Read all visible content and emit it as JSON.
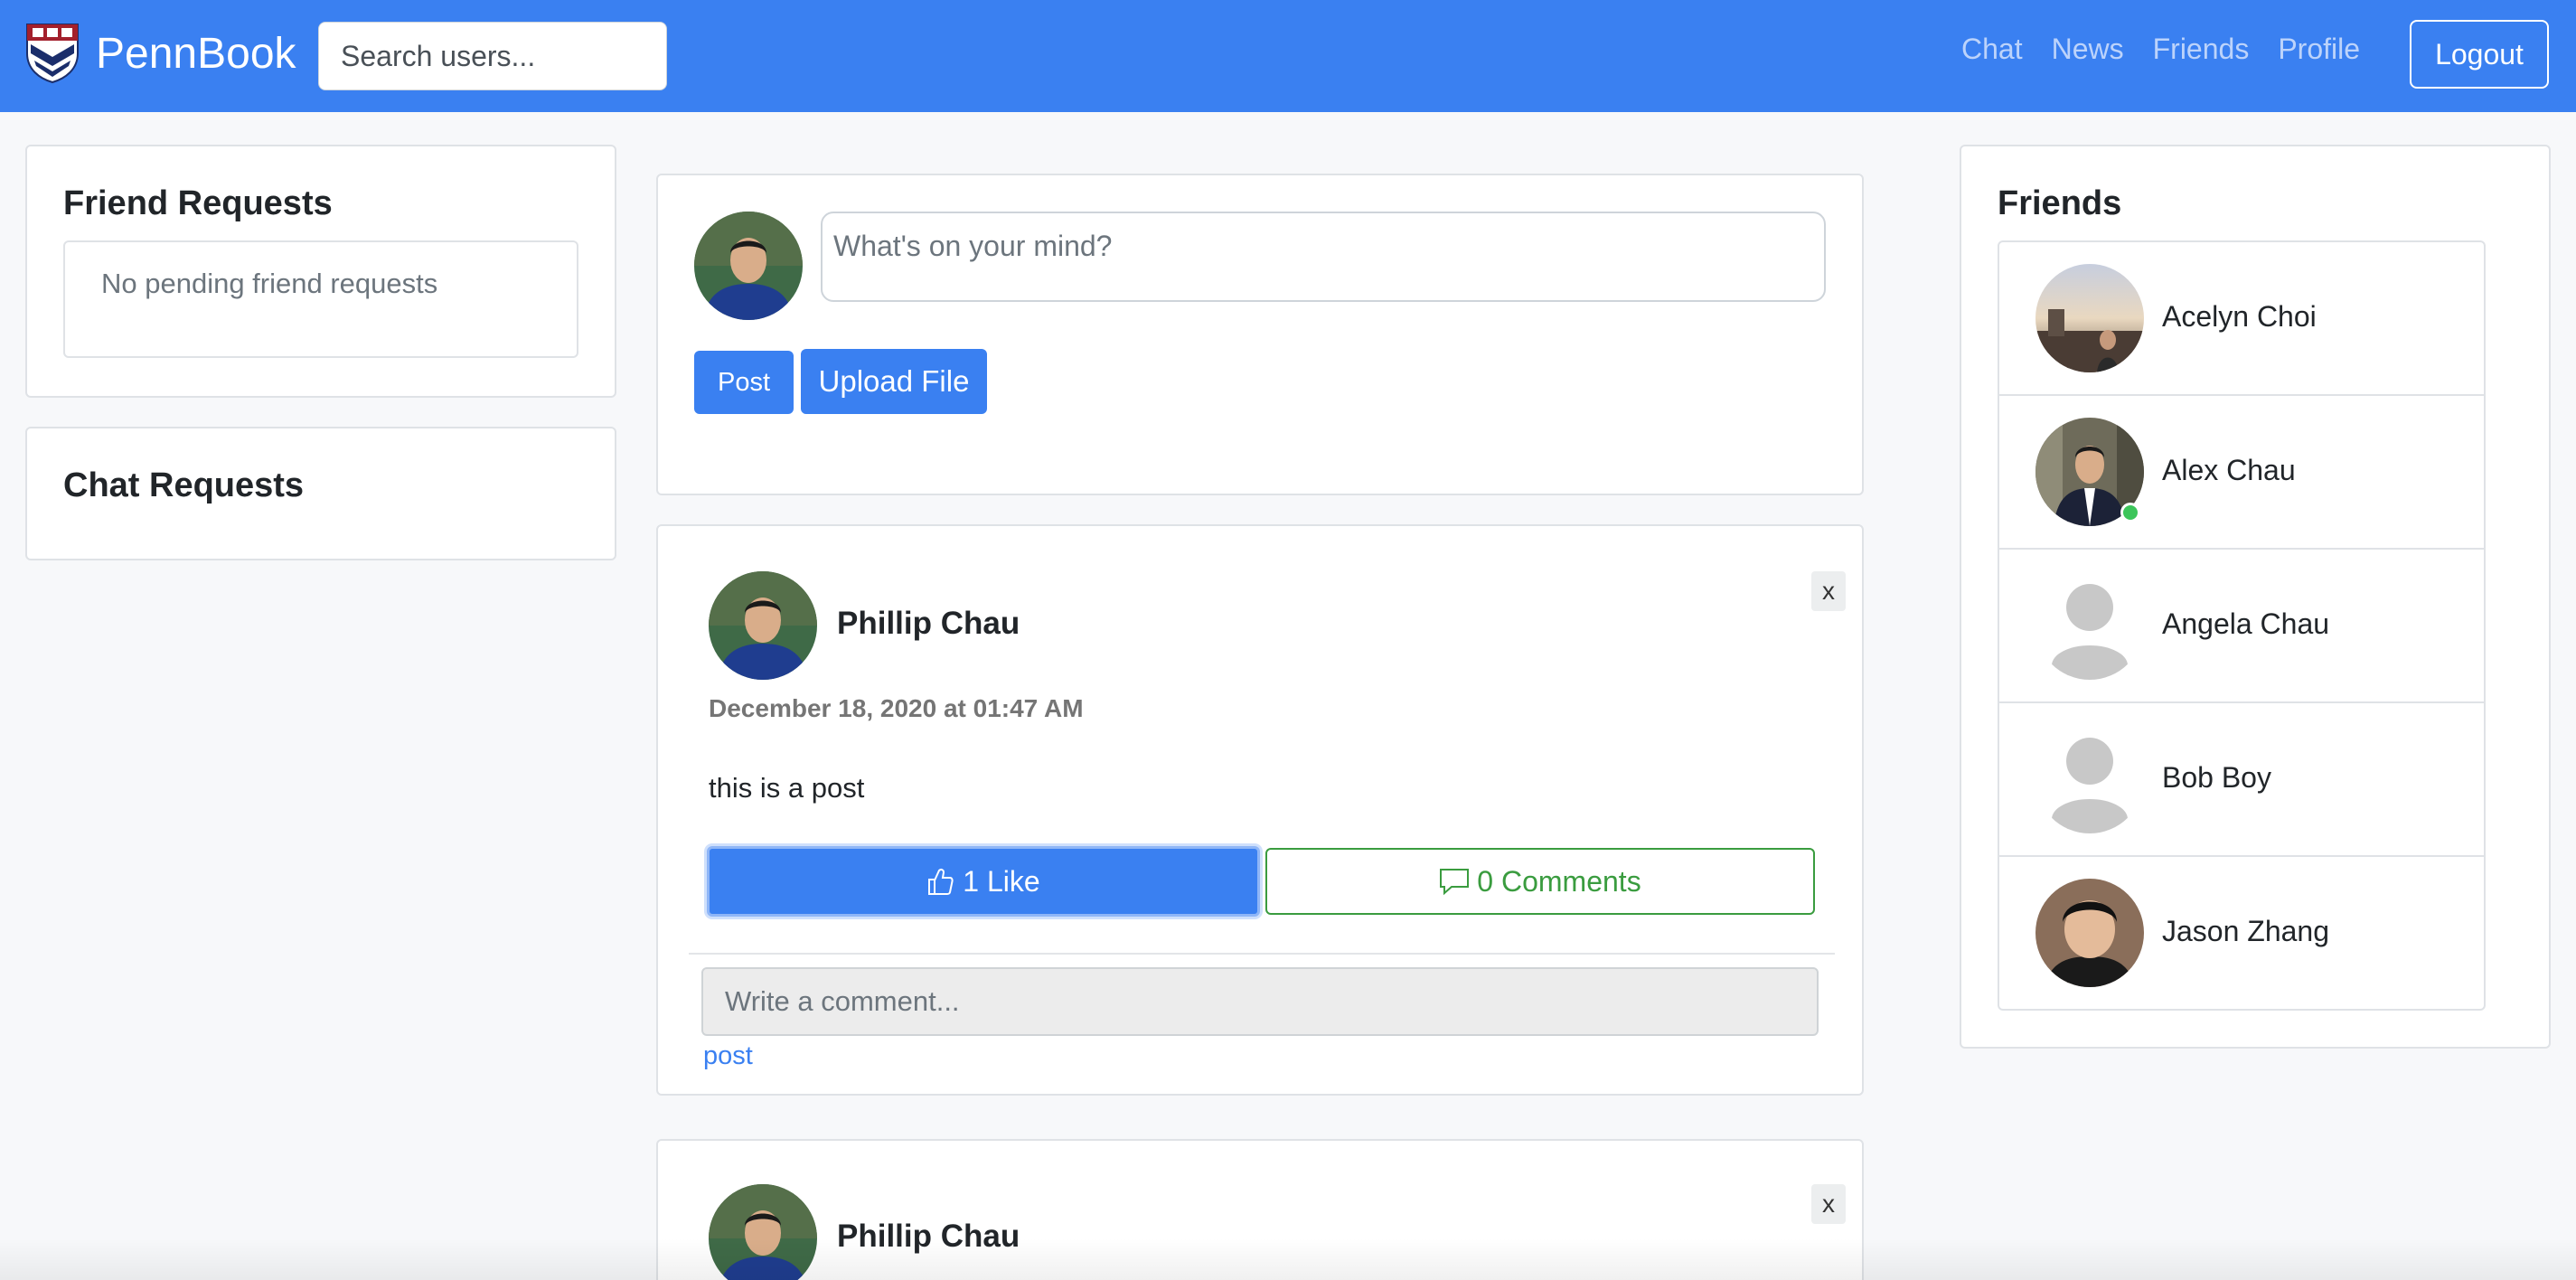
{
  "navbar": {
    "brand_name": "PennBook",
    "search_placeholder": "Search users...",
    "links": [
      "Chat",
      "News",
      "Friends",
      "Profile"
    ],
    "logout_label": "Logout",
    "background_color": "#3a80f1"
  },
  "friend_requests": {
    "title": "Friend Requests",
    "empty_text": "No pending friend requests"
  },
  "chat_requests": {
    "title": "Chat Requests"
  },
  "composer": {
    "placeholder": "What's on your mind?",
    "post_label": "Post",
    "upload_label": "Upload File"
  },
  "posts": [
    {
      "author": "Phillip Chau",
      "date": "December 18, 2020 at 01:47 AM",
      "body": "this is a post",
      "like_label": "1 Like",
      "comments_label": "0 Comments",
      "comment_placeholder": "Write a comment...",
      "comment_submit_label": "post",
      "close_label": "x"
    },
    {
      "author": "Phillip Chau",
      "close_label": "x"
    }
  ],
  "friends": {
    "title": "Friends",
    "items": [
      {
        "name": "Acelyn Choi",
        "online": false,
        "avatar": "photo"
      },
      {
        "name": "Alex Chau",
        "online": true,
        "avatar": "photo"
      },
      {
        "name": "Angela Chau",
        "online": false,
        "avatar": "default"
      },
      {
        "name": "Bob Boy",
        "online": false,
        "avatar": "default"
      },
      {
        "name": "Jason Zhang",
        "online": false,
        "avatar": "photo"
      }
    ]
  },
  "icons": {
    "logo": "penn-shield-icon",
    "like": "thumbs-up-icon",
    "comments": "speech-bubble-icon",
    "default_avatar": "user-silhouette-icon"
  },
  "colors": {
    "primary": "#3a80f1",
    "success": "#3a9c3f",
    "online": "#3cc55a"
  }
}
